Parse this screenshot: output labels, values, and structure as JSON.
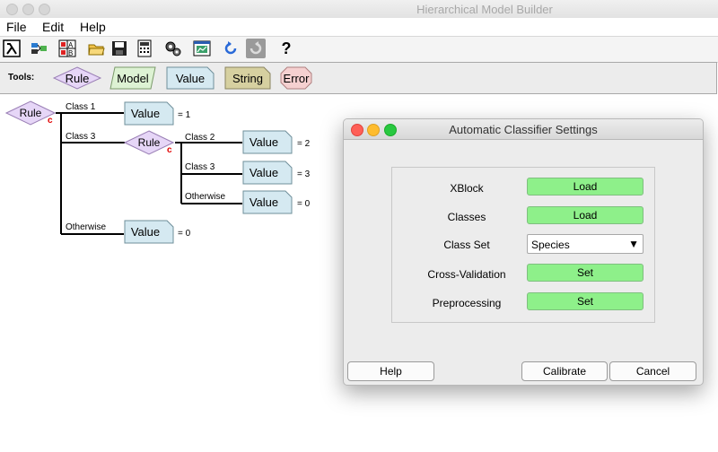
{
  "window": {
    "title": "Hierarchical Model Builder"
  },
  "menu": {
    "items": [
      "File",
      "Edit",
      "Help"
    ]
  },
  "toolbar": {
    "icons": [
      "lambda-icon",
      "model-connect-icon",
      "ab-table-icon",
      "open-folder-icon",
      "save-disk-icon",
      "calculator-icon",
      "gears-icon",
      "chart-window-icon",
      "undo-icon",
      "redo-icon",
      "help-icon"
    ],
    "help_label": "?"
  },
  "tools": {
    "label": "Tools:",
    "items": [
      {
        "label": "Rule",
        "color": "#e6d6f7"
      },
      {
        "label": "Model",
        "color": "#ddf2d3"
      },
      {
        "label": "Value",
        "color": "#d5e9f1"
      },
      {
        "label": "String",
        "color": "#d6d0a0"
      },
      {
        "label": "Error",
        "color": "#f5d0d0"
      }
    ]
  },
  "tree": {
    "root": {
      "label": "Rule",
      "mark": "c"
    },
    "branches": [
      {
        "edge": "Class 1",
        "node": "Value",
        "result": "= 1"
      },
      {
        "edge": "Class 3",
        "node": "Rule",
        "mark": "c"
      },
      {
        "edge": "Otherwise",
        "node": "Value",
        "result": "= 0"
      }
    ],
    "sub_branches": [
      {
        "edge": "Class 2",
        "node": "Value",
        "result": "= 2"
      },
      {
        "edge": "Class 3",
        "node": "Value",
        "result": "= 3"
      },
      {
        "edge": "Otherwise",
        "node": "Value",
        "result": "= 0"
      }
    ]
  },
  "dialog": {
    "title": "Automatic Classifier Settings",
    "rows": [
      {
        "label": "XBlock",
        "button": "Load"
      },
      {
        "label": "Classes",
        "button": "Load"
      },
      {
        "label": "Class Set",
        "select_value": "Species",
        "select_arrow": "▼"
      },
      {
        "label": "Cross-Validation",
        "button": "Set"
      },
      {
        "label": "Preprocessing",
        "button": "Set"
      }
    ],
    "buttons": {
      "help": "Help",
      "calibrate": "Calibrate",
      "cancel": "Cancel"
    }
  },
  "colors": {
    "green_button": "#8ef08a",
    "value_node": "#d5e9f1",
    "rule_node": "#e6d6f7",
    "close": "#fe5f57",
    "minimize": "#febc2e",
    "zoom": "#28c840",
    "mark": "#e00000"
  }
}
